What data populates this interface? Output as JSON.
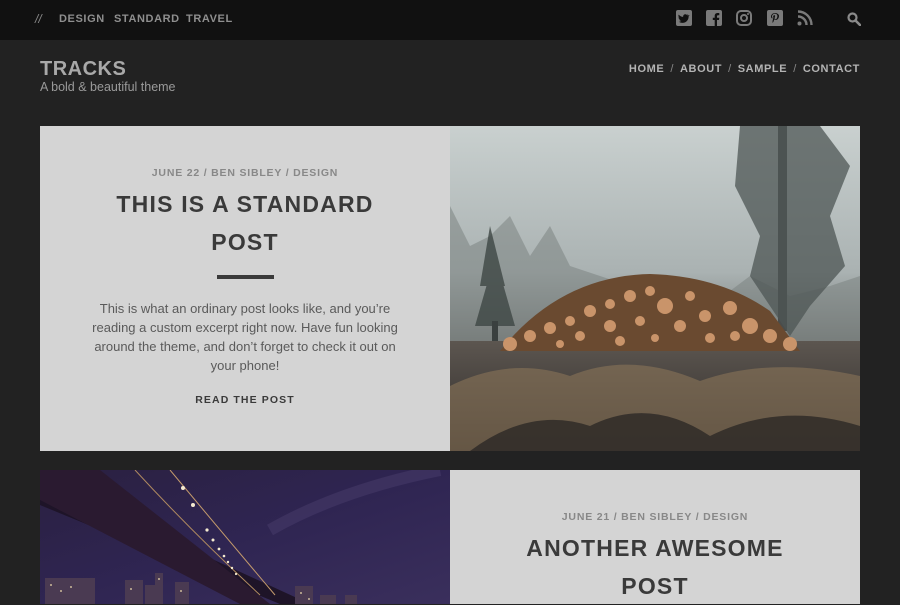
{
  "topbar": {
    "slashes": "//",
    "categories": [
      "DESIGN",
      "STANDARD",
      "TRAVEL"
    ],
    "social_icons": [
      "twitter-icon",
      "facebook-icon",
      "instagram-icon",
      "pinterest-icon",
      "rss-icon"
    ],
    "search_icon": "search-icon"
  },
  "header": {
    "site_title": "TRACKS",
    "tagline": "A bold & beautiful theme",
    "nav": [
      "HOME",
      "ABOUT",
      "SAMPLE",
      "CONTACT"
    ],
    "nav_separator": "/"
  },
  "posts": [
    {
      "meta": "JUNE 22 / BEN SIBLEY / DESIGN",
      "title_line1": "THIS IS A STANDARD",
      "title_line2": "POST",
      "excerpt_lines": [
        "This is what an ordinary post looks like, and you’re",
        "reading a custom excerpt right now. Have fun looking",
        "around the theme, and don’t forget to check it out on",
        "your phone!"
      ],
      "read_more": "READ THE POST",
      "image": "foggy forest with stacked logs"
    },
    {
      "meta": "JUNE 21 / BEN SIBLEY / DESIGN",
      "title_line1": "ANOTHER AWESOME",
      "title_line2": "POST",
      "image": "suspension bridge over city skyline at night"
    }
  ],
  "colors": {
    "topbar_bg": "#111111",
    "page_bg": "#222222",
    "panel_bg": "#d4d4d4",
    "title_text": "#3a3a3a",
    "meta_text": "#888888"
  }
}
